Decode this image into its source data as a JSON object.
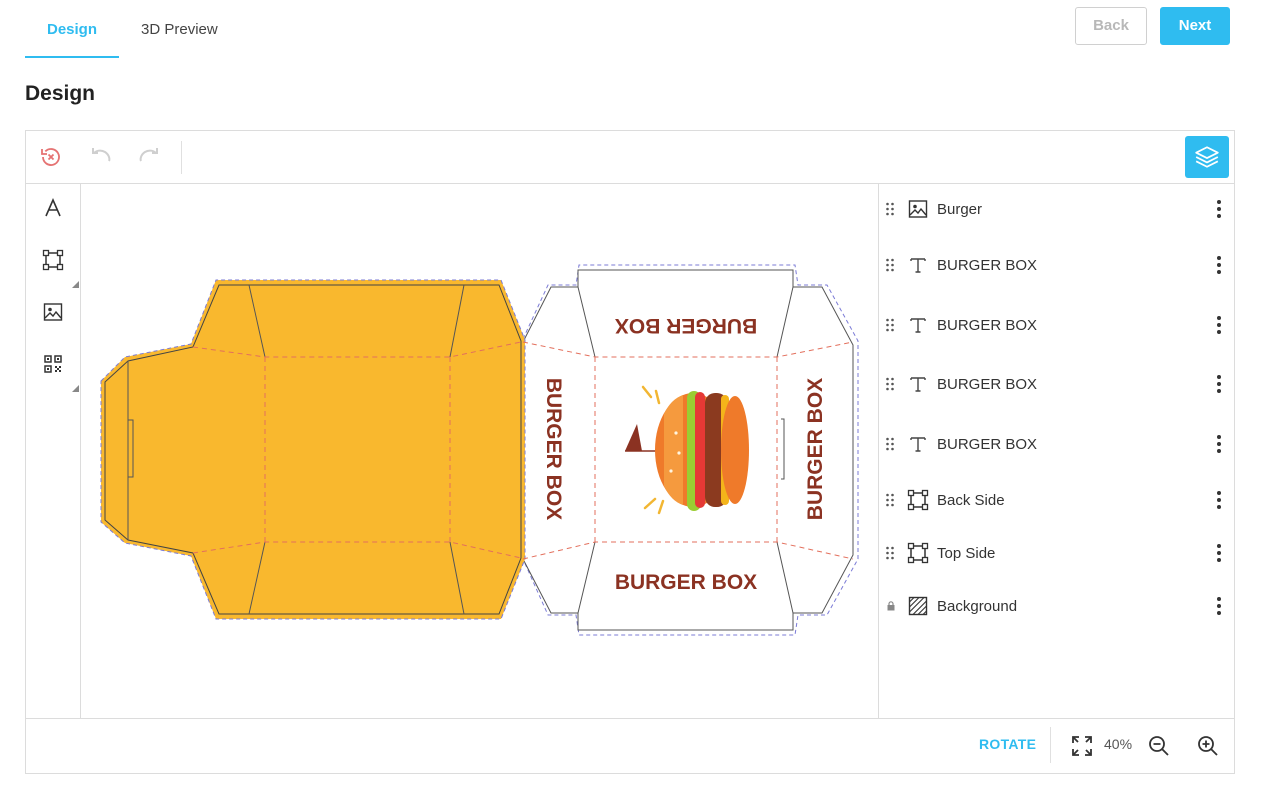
{
  "tabs": [
    {
      "label": "Design",
      "active": true
    },
    {
      "label": "3D Preview",
      "active": false
    }
  ],
  "nav": {
    "back_label": "Back",
    "next_label": "Next"
  },
  "page_title": "Design",
  "toolbar": {
    "icons": [
      "reset-icon",
      "undo-icon",
      "redo-icon"
    ],
    "layers_icon": "layers-icon"
  },
  "tools": [
    "text-tool-icon",
    "shape-tool-icon",
    "image-tool-icon",
    "qr-code-tool-icon"
  ],
  "canvas": {
    "box_color": "#F9B82E",
    "text_color": "#8B3222",
    "label_top": "BURGER BOX",
    "label_left": "BURGER BOX",
    "label_right": "BURGER BOX",
    "label_bottom": "BURGER BOX"
  },
  "layers": [
    {
      "type": "image",
      "icon": "image-icon",
      "name": "Burger",
      "locked": false
    },
    {
      "type": "text",
      "icon": "text-icon",
      "name": "BURGER BOX",
      "locked": false
    },
    {
      "type": "text",
      "icon": "text-icon",
      "name": "BURGER BOX",
      "locked": false
    },
    {
      "type": "text",
      "icon": "text-icon",
      "name": "BURGER BOX",
      "locked": false
    },
    {
      "type": "text",
      "icon": "text-icon",
      "name": "BURGER BOX",
      "locked": false
    },
    {
      "type": "shape",
      "icon": "shape-icon",
      "name": "Back Side",
      "locked": false
    },
    {
      "type": "shape",
      "icon": "shape-icon",
      "name": "Top Side",
      "locked": false
    },
    {
      "type": "background",
      "icon": "background-icon",
      "name": "Background",
      "locked": true
    }
  ],
  "bottom": {
    "rotate_label": "ROTATE",
    "zoom": "40%"
  },
  "colors": {
    "accent": "#2FBCF0"
  }
}
